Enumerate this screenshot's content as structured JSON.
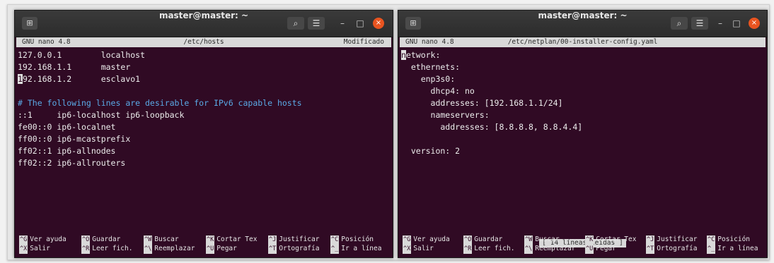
{
  "left": {
    "title": "master@master: ~",
    "nano_version": "GNU nano 4.8",
    "file": "/etc/hosts",
    "modified": "Modificado",
    "lines": [
      "127.0.0.1        localhost",
      "192.168.1.1      master",
      "192.168.1.2      esclavo1",
      "",
      "# The following lines are desirable for IPv6 capable hosts",
      "::1     ip6-localhost ip6-loopback",
      "fe00::0 ip6-localnet",
      "ff00::0 ip6-mcastprefix",
      "ff02::1 ip6-allnodes",
      "ff02::2 ip6-allrouters"
    ],
    "shortcuts": [
      {
        "key": "^G",
        "label": "Ver ayuda"
      },
      {
        "key": "^O",
        "label": "Guardar"
      },
      {
        "key": "^W",
        "label": "Buscar"
      },
      {
        "key": "^K",
        "label": "Cortar Tex"
      },
      {
        "key": "^J",
        "label": "Justificar"
      },
      {
        "key": "^C",
        "label": "Posición"
      },
      {
        "key": "^X",
        "label": "Salir"
      },
      {
        "key": "^R",
        "label": "Leer fich."
      },
      {
        "key": "^\\",
        "label": "Reemplazar"
      },
      {
        "key": "^U",
        "label": "Pegar"
      },
      {
        "key": "^T",
        "label": "Ortografía"
      },
      {
        "key": "^_",
        "label": "Ir a línea"
      }
    ]
  },
  "right": {
    "title": "master@master: ~",
    "nano_version": "GNU nano 4.8",
    "file": "/etc/netplan/00-installer-config.yaml",
    "lines": [
      "network:",
      "  ethernets:",
      "    enp3s0:",
      "      dhcp4: no",
      "      addresses: [192.168.1.1/24]",
      "      nameservers:",
      "        addresses: [8.8.8.8, 8.8.4.4]",
      "",
      "  version: 2"
    ],
    "status_message": "[ 14 líneas leídas ]",
    "shortcuts": [
      {
        "key": "^G",
        "label": "Ver ayuda"
      },
      {
        "key": "^O",
        "label": "Guardar"
      },
      {
        "key": "^W",
        "label": "Buscar"
      },
      {
        "key": "^K",
        "label": "Cortar Tex"
      },
      {
        "key": "^J",
        "label": "Justificar"
      },
      {
        "key": "^C",
        "label": "Posición"
      },
      {
        "key": "^X",
        "label": "Salir"
      },
      {
        "key": "^R",
        "label": "Leer fich."
      },
      {
        "key": "^\\",
        "label": "Reemplazar"
      },
      {
        "key": "^U",
        "label": "Pegar"
      },
      {
        "key": "^T",
        "label": "Ortografía"
      },
      {
        "key": "^_",
        "label": "Ir a línea"
      }
    ]
  },
  "icons": {
    "terminal_tab": "⊞",
    "search": "⌕",
    "menu": "☰",
    "minimize": "–",
    "maximize": "□",
    "close": "×"
  },
  "colors": {
    "terminal_bg": "#300a24",
    "ubuntu_orange": "#e95420",
    "comment": "#5aa9e6"
  }
}
